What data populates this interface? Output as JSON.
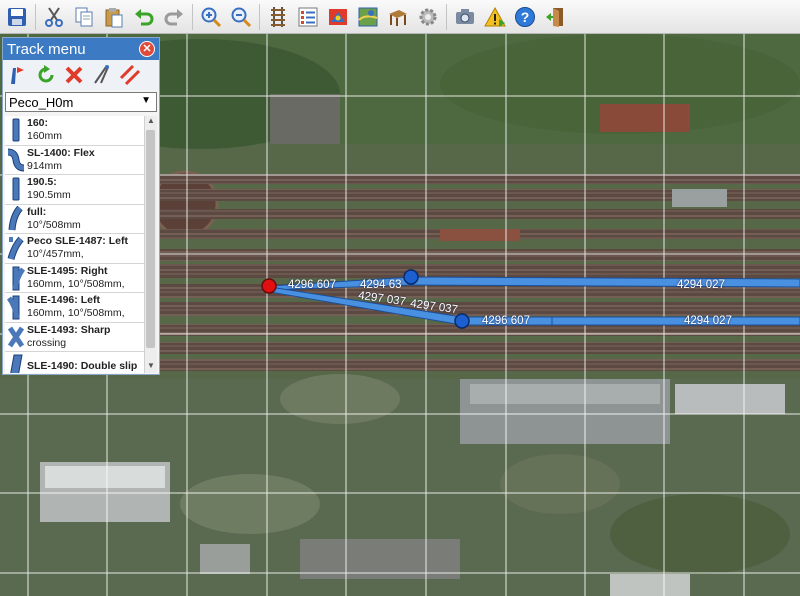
{
  "toolbar": {
    "buttons": [
      "save-icon",
      "cut-icon",
      "copy-icon",
      "paste-icon",
      "undo-icon",
      "redo-icon",
      "zoom-in-icon",
      "zoom-out-icon",
      "track-icon",
      "list-icon",
      "signal-icon",
      "map-icon",
      "table-icon",
      "settings-icon",
      "camera-icon",
      "warning-icon",
      "help-icon",
      "exit-icon"
    ]
  },
  "panel": {
    "title": "Track menu",
    "tools": [
      "draw-track-icon",
      "rotate-icon",
      "delete-icon",
      "measure-icon",
      "parallel-track-icon"
    ],
    "library": "Peco_H0m",
    "items": [
      {
        "name": "160:",
        "detail": "160mm"
      },
      {
        "name": "SL-1400: Flex",
        "detail": "914mm"
      },
      {
        "name": "190.5:",
        "detail": "190.5mm"
      },
      {
        "name": "full:",
        "detail": "10°/508mm"
      },
      {
        "name": "Peco SLE-1487: Left",
        "detail": "10°/457mm,"
      },
      {
        "name": "SLE-1495: Right",
        "detail": "160mm, 10°/508mm,"
      },
      {
        "name": "SLE-1496: Left",
        "detail": "160mm, 10°/508mm,"
      },
      {
        "name": "SLE-1493: Sharp",
        "detail": "crossing"
      },
      {
        "name": "SLE-1490: Double slip",
        "detail": ""
      }
    ]
  },
  "tracks": {
    "labels": [
      "4296 607",
      "4294 63",
      "4294 027",
      "4297 037",
      "4297 037",
      "4296 607",
      "4294 027"
    ]
  },
  "colors": {
    "accent": "#3c7ac4",
    "track": "#4a90e0",
    "node": "#1c5fd0",
    "selected_node": "#e01010"
  }
}
